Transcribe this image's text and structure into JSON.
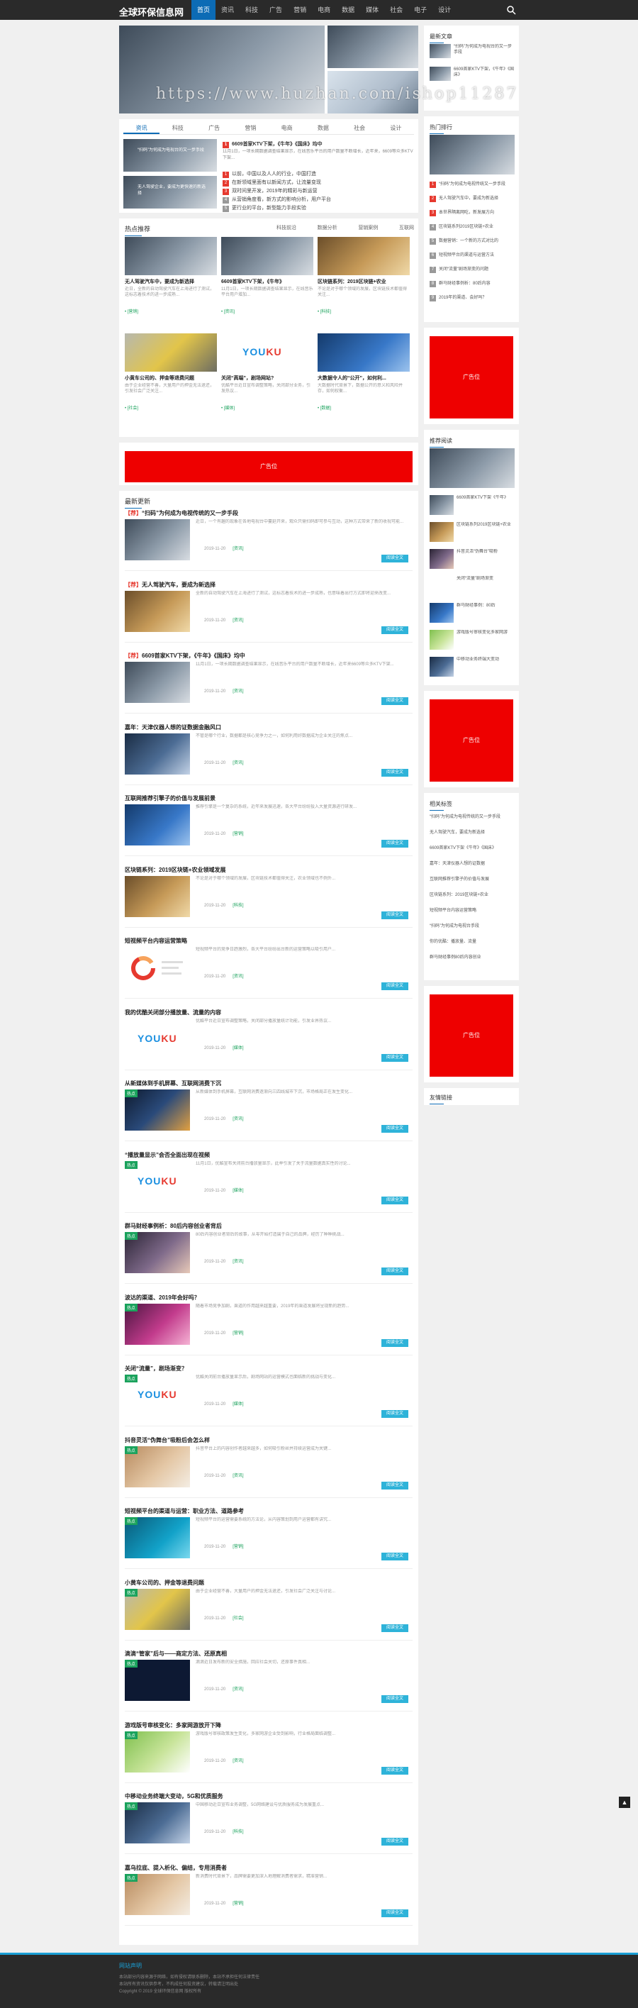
{
  "site": {
    "name": "全球环保信息网"
  },
  "nav": {
    "items": [
      {
        "label": "首页",
        "active": true
      },
      {
        "label": "资讯"
      },
      {
        "label": "科技"
      },
      {
        "label": "广告"
      },
      {
        "label": "营销"
      },
      {
        "label": "电商"
      },
      {
        "label": "数据"
      },
      {
        "label": "媒体"
      },
      {
        "label": "社会"
      },
      {
        "label": "电子"
      },
      {
        "label": "设计"
      }
    ]
  },
  "watermark": "https://www.huzhan.com/ishop11287",
  "tabs": [
    "资讯",
    "科技",
    "广告",
    "营销",
    "电商",
    "数据",
    "社会",
    "设计"
  ],
  "featured": {
    "left_items": [
      {
        "title": "“扫码”为何成为电视台的又一步手段"
      },
      {
        "title": "无人驾驶企业，要成为更快速的新选择"
      }
    ],
    "headline": "6609首家KTV下架，《牛年》《国床》均中",
    "headline_desc": "11月1日，一项长期数据调查结果显示，在线音乐平台的用户数量不断增长，近年来，6609等众多KTV下架...",
    "list": [
      {
        "n": "1",
        "text": "以前，中国以及人人的行业，中国打造",
        "hot": true
      },
      {
        "n": "2",
        "text": "在新领域里面有以新闻方式，让流量变现",
        "hot": true
      },
      {
        "n": "3",
        "text": "双时间里开发，2019年的精彩与新运营",
        "hot": true
      },
      {
        "n": "4",
        "text": "从营销角度看，新方式的影响分析，用户平台",
        "hot": false
      },
      {
        "n": "5",
        "text": "更行业的平台，新型能力手段实验",
        "hot": false
      }
    ]
  },
  "grid": {
    "title": "热点推荐",
    "links": [
      "科技前沿",
      "数据分析",
      "营销案例",
      "互联网"
    ],
    "cards": [
      {
        "title": "无人驾驶汽车中，要成为新选择",
        "desc": "近日，全新的自动驾驶汽车在上海进行了测试，这标志着技术的进一步成熟...",
        "tag": "• [营销]"
      },
      {
        "title": "6609首家KTV下架，《牛年》",
        "desc": "11月1日，一项长期数据调查结果显示，在线音乐平台用户增加...",
        "tag": "• [资讯]"
      },
      {
        "title": "区块链系列：2019区块链+农业",
        "desc": "不论是对于哪个领域的发展，区块链技术都值得关注...",
        "tag": "• [科技]"
      },
      {
        "title": "小黄车公司的、押金等退费问题",
        "desc": "由于企业经营不善，大量用户的押金无法退还，引发社会广泛关注...",
        "tag": "• [社会]"
      },
      {
        "title": "关闭“高端”，剧场网站?",
        "desc": "优酷平台近日宣布调整策略，关闭部分业务，引发热议...",
        "tag": "• [媒体]"
      },
      {
        "title": "大数据令人的“公开”，如何利...",
        "desc": "大数据时代背景下，数据公开的意义和风险并存，如何权衡...",
        "tag": "• [数据]"
      }
    ]
  },
  "ad_text": "广告位",
  "latest": {
    "title": "最新更新",
    "read_label": "阅读全文",
    "entries": [
      {
        "prefix": "【荐】",
        "title": "“扫码”为何成为电视传统的又一步手段",
        "desc": "近日，一个有趣的现象在各地电视台中蔓延开来，观众只需扫码即可参与互动，这种方式带来了新的收视可能...",
        "date": "2019-11-20",
        "cat": "[资讯]",
        "badge": "",
        "img": "ph-dark"
      },
      {
        "prefix": "【荐】",
        "title": "无人驾驶汽车，要成为新选择",
        "desc": "全新的自动驾驶汽车在上海进行了测试，这标志着技术的进一步成熟，也意味着出行方式即将迎来改变...",
        "date": "2019-11-20",
        "cat": "[资讯]",
        "badge": "",
        "img": "ph-gold"
      },
      {
        "prefix": "【荐】",
        "title": "6609首家KTV下架，《牛年》《国床》均中",
        "desc": "11月1日，一项长期数据调查结果显示，在线音乐平台的用户数量不断增长，近年来6609等众多KTV下架...",
        "date": "2019-11-20",
        "cat": "[资讯]",
        "badge": "",
        "img": "ph-dark"
      },
      {
        "prefix": "",
        "title": "嘉年：天津仪器人想的证数据金融风口",
        "desc": "不管是哪个行业，数据都是核心竞争力之一，如何利用好数据成为企业关注的焦点...",
        "date": "2019-11-20",
        "cat": "[资讯]",
        "badge": "",
        "img": "ph-city"
      },
      {
        "prefix": "",
        "title": "互联网推荐引擎子的价值与发展前景",
        "desc": "推荐引擎是一个复杂的系统，近年来发展迅速，各大平台纷纷投入大量资源进行研发...",
        "date": "2019-11-20",
        "cat": "[营销]",
        "badge": "",
        "img": "ph-blue"
      },
      {
        "prefix": "",
        "title": "区块链系列：2019区块链+农业领域发展",
        "desc": "不论是对于哪个领域的发展，区块链技术都值得关注，农业领域也不例外...",
        "date": "2019-11-20",
        "cat": "[科技]",
        "badge": "",
        "img": "ph-gold"
      },
      {
        "prefix": "",
        "title": "短视频平台内容运营策略",
        "desc": "短视频平台的竞争日趋激烈，各大平台纷纷出台新的运营策略以吸引用户...",
        "date": "2019-11-20",
        "cat": "[资讯]",
        "badge": "",
        "img": "ph-chart"
      },
      {
        "prefix": "",
        "title": "我的优酷关闭部分播放量、流量的内容",
        "desc": "优酷平台近日宣布调整策略，关闭部分播放量统计功能，引发业界热议...",
        "date": "2019-11-20",
        "cat": "[媒体]",
        "badge": "",
        "img": "ph-youku"
      },
      {
        "prefix": "",
        "title": "从新媒体到手机屏幕、互联网消费下沉",
        "desc": "从新媒体到手机屏幕，互联网消费逐渐向三四线城市下沉，市场格局正在发生变化...",
        "date": "2019-11-20",
        "cat": "[资讯]",
        "badge": "热点",
        "img": "ph-night"
      },
      {
        "prefix": "",
        "title": "“播放量显示”会否全面出现在视频",
        "desc": "11月1日，优酷宣布关闭前台播放量显示，此举引发了关于流量数据真实性的讨论...",
        "date": "2019-11-20",
        "cat": "[媒体]",
        "badge": "热点",
        "img": "ph-youku"
      },
      {
        "prefix": "",
        "title": "群马财经事例析：80后内容创业者背后",
        "desc": "80后内容创业者背后的故事，从零开始打造属于自己的品牌，经历了种种挑战...",
        "date": "2019-11-20",
        "cat": "[资讯]",
        "badge": "热点",
        "img": "ph-girl"
      },
      {
        "prefix": "",
        "title": "波达的渠道、2019年会好吗？",
        "desc": "随着市场竞争加剧，渠道的作用越来越重要，2019年的渠道发展将呈现新的趋势...",
        "date": "2019-11-20",
        "cat": "[营销]",
        "badge": "热点",
        "img": "ph-pink"
      },
      {
        "prefix": "",
        "title": "关闭“流量”，剧场渐变？",
        "desc": "优酷关闭前台播放量显示后，剧场网站的运营模式也面临新的挑战与变化...",
        "date": "2019-11-20",
        "cat": "[媒体]",
        "badge": "热点",
        "img": "ph-youku"
      },
      {
        "prefix": "",
        "title": "抖音灵活“伪舞台”吸粉后会怎么样",
        "desc": "抖音平台上的内容创作者越来越多，如何吸引粉丝并持续运营成为关键...",
        "date": "2019-11-20",
        "cat": "[资讯]",
        "badge": "热点",
        "img": "ph-hands"
      },
      {
        "prefix": "",
        "title": "短视频平台的渠道与运营：职业方法、道路参考",
        "desc": "短视频平台的运营需要系统的方法论，从内容策划到用户运营都有讲究...",
        "date": "2019-11-20",
        "cat": "[营销]",
        "badge": "热点",
        "img": "ph-tiktok"
      },
      {
        "prefix": "",
        "title": "小黄车公司的、押金等退费问题",
        "desc": "由于企业经营不善，大量用户的押金无法退还，引发社会广泛关注与讨论...",
        "date": "2019-11-20",
        "cat": "[社会]",
        "badge": "热点",
        "img": "ph-bike"
      },
      {
        "prefix": "",
        "title": "滴滴“管家”后与——商定方法、还原真相",
        "desc": "滴滴近日发布新的安全措施，回应社会关切，还原事件真相...",
        "date": "2019-11-20",
        "cat": "[资讯]",
        "badge": "热点",
        "img": "ph-didi"
      },
      {
        "prefix": "",
        "title": "游戏版号审核变化：多家网游放开下降",
        "desc": "游戏版号审核政策发生变化，多家网游企业受到影响，行业格局面临调整...",
        "date": "2019-11-20",
        "cat": "[资讯]",
        "badge": "热点",
        "img": "ph-green"
      },
      {
        "prefix": "",
        "title": "中移动业务终端大变动，5G和优质服务",
        "desc": "中国移动近日宣布业务调整，5G网络建设与优质服务成为发展重点...",
        "date": "2019-11-20",
        "cat": "[科技]",
        "badge": "热点",
        "img": "ph-city"
      },
      {
        "prefix": "",
        "title": "嘉乌拉底、提入析化、偏结，专用消费者",
        "desc": "新消费时代背景下，品牌需要更加深入地理解消费者需求，精准营销...",
        "date": "2019-11-20",
        "cat": "[营销]",
        "badge": "热点",
        "img": "ph-hands"
      }
    ]
  },
  "sidebar": {
    "latest_title": "最新文章",
    "latest_list": [
      "“扫码”为何成为电视台的又一步手段",
      "6609首家KTV下架，《牛年》《国床》"
    ],
    "hot_title": "热门排行",
    "hot_list": [
      "“扫码”为何成为电视传统又一步手段",
      "无人驾驶汽车中，要成为新选择",
      "本世界隔离网吃，新发展方向",
      "区块链系列2019区块链+农业",
      "数据营销：一个新的方式对比的",
      "短视频平台的渠道与运营方法",
      "关闭“流量”剧场渐变的问题",
      "群马财经事例析：80后内容",
      "2019年的渠道、会好吗？"
    ],
    "ad1": "广告位",
    "rec_title": "推荐阅读",
    "rec_items": [
      "6609首家KTV下架《牛年》",
      "区块链系列2019区块链+农业",
      "抖音灵活“伪舞台”吸粉",
      "关闭“流量”剧场渐变",
      "群马财经事例：80后",
      "游戏版号审核变化多家网游",
      "中移动业务终端大变动"
    ],
    "ad2": "广告位",
    "tag_title": "相关标签",
    "tag_list": [
      "“扫码”为何成为电视传统的又一步手段",
      "无人驾驶汽车，要成为新选择",
      "6609首家KTV下架《牛年》《国床》",
      "嘉年：天津仪器人想的证数据",
      "互联网推荐引擎子的价值与发展",
      "区块链系列：2019区块链+农业",
      "短视频平台内容运营策略",
      "“扫码”为何成为电视台手段",
      "你的优酷：播放量、流量",
      "群马财经事例80后内容创业"
    ],
    "ad3": "广告位",
    "links_title": "友情链接"
  },
  "footer": {
    "title": "网站声明",
    "lines": [
      "本站部分内容来源于网络，如有侵权请联系删除，本站不承担任何法律责任",
      "本站所有资讯仅供参考，不构成任何投资建议，转载请注明出处",
      "Copyright © 2019 全球环保信息网 版权所有"
    ]
  }
}
